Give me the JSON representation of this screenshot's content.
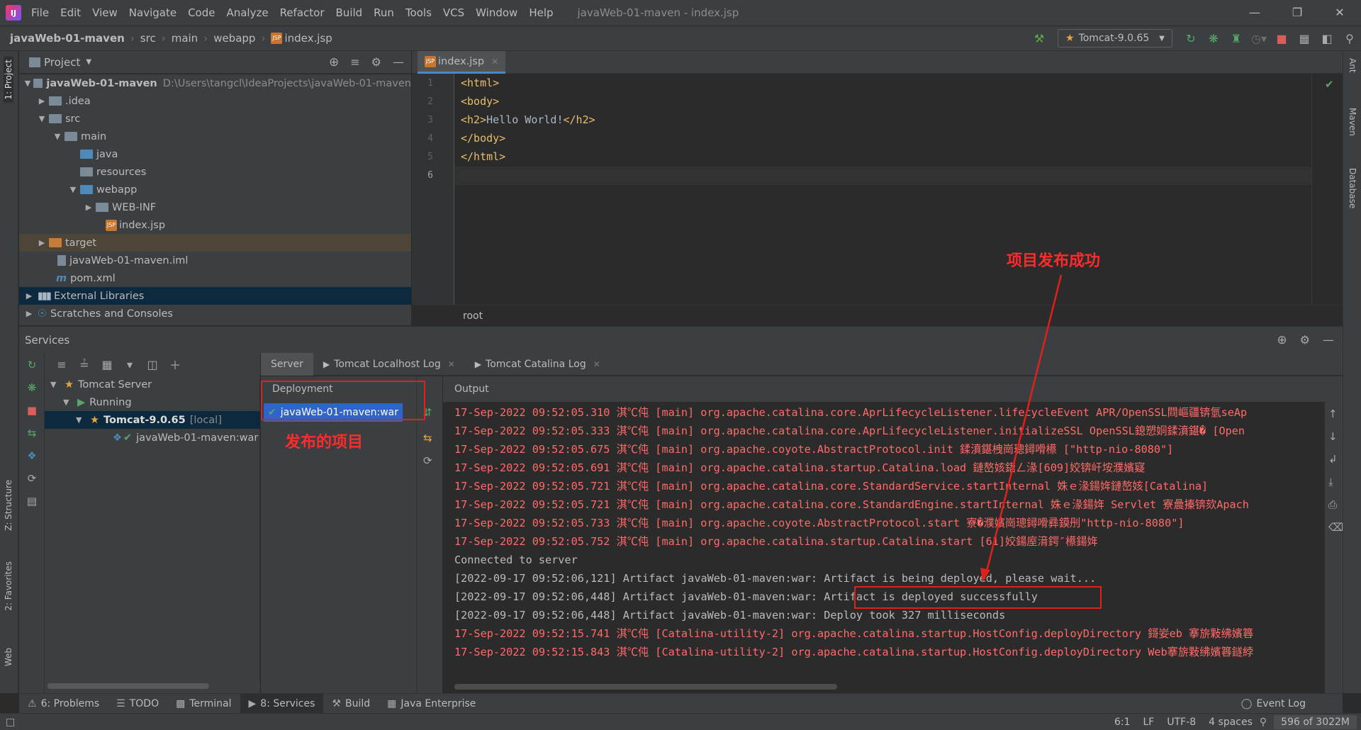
{
  "menubar": {
    "items": [
      "File",
      "Edit",
      "View",
      "Navigate",
      "Code",
      "Analyze",
      "Refactor",
      "Build",
      "Run",
      "Tools",
      "VCS",
      "Window",
      "Help"
    ],
    "window_title": "javaWeb-01-maven - index.jsp"
  },
  "navbar": {
    "crumbs": [
      "javaWeb-01-maven",
      "src",
      "main",
      "webapp",
      "index.jsp"
    ],
    "run_config": "Tomcat-9.0.65"
  },
  "left_strip": {
    "project": "1: Project",
    "structure": "Z: Structure",
    "favorites": "2: Favorites",
    "web": "Web"
  },
  "right_strip": {
    "ant": "Ant",
    "maven": "Maven",
    "database": "Database"
  },
  "project_panel": {
    "title": "Project",
    "tree": [
      {
        "label": "javaWeb-01-maven",
        "path": "D:\\Users\\tangcl\\IdeaProjects\\javaWeb-01-maven"
      },
      {
        "label": ".idea"
      },
      {
        "label": "src"
      },
      {
        "label": "main"
      },
      {
        "label": "java"
      },
      {
        "label": "resources"
      },
      {
        "label": "webapp"
      },
      {
        "label": "WEB-INF"
      },
      {
        "label": "index.jsp"
      },
      {
        "label": "target"
      },
      {
        "label": "javaWeb-01-maven.iml"
      },
      {
        "label": "pom.xml"
      },
      {
        "label": "External Libraries"
      },
      {
        "label": "Scratches and Consoles"
      }
    ]
  },
  "editor": {
    "tab": "index.jsp",
    "line_numbers": [
      "1",
      "2",
      "3",
      "4",
      "5",
      "6"
    ],
    "lines": [
      {
        "tag": "<html>",
        "text": ""
      },
      {
        "tag": "<body>",
        "text": ""
      },
      {
        "tag": "<h2>",
        "text": "Hello World!",
        "tag2": "</h2>"
      },
      {
        "tag": "</body>",
        "text": ""
      },
      {
        "tag": "</html>",
        "text": ""
      }
    ],
    "breadcrumb": "root"
  },
  "services": {
    "title": "Services",
    "tree": [
      {
        "label": "Tomcat Server"
      },
      {
        "label": "Running"
      },
      {
        "label": "Tomcat-9.0.65",
        "suffix": "[local]"
      },
      {
        "label": "javaWeb-01-maven:war"
      }
    ],
    "tabs": [
      "Server",
      "Tomcat Localhost Log",
      "Tomcat Catalina Log"
    ],
    "deployment_header": "Deployment",
    "deployment_item": "javaWeb-01-maven:war",
    "output_header": "Output",
    "log": [
      {
        "kind": "red",
        "text": "17-Sep-2022 09:52:05.310 淇℃伅 [main] org.apache.catalina.core.AprLifecycleListener.lifecycleEvent APR/OpenSSL閰嶇疆锛氫seAp"
      },
      {
        "kind": "red",
        "text": "17-Sep-2022 09:52:05.333 淇℃伅 [main] org.apache.catalina.core.AprLifecycleListener.initializeSSL OpenSSL鎴愬姛鍒濆鍖� [Open"
      },
      {
        "kind": "red",
        "text": "17-Sep-2022 09:52:05.675 淇℃伅 [main] org.apache.coyote.AbstractProtocol.init 鍒濆鍖栧崗璁鐞嗗櫒 [\"http-nio-8080\"]"
      },
      {
        "kind": "red",
        "text": "17-Sep-2022 09:52:05.691 淇℃伅 [main] org.apache.catalina.startup.Catalina.load 鏈嶅姟鍣ㄥ湪[609]姣锛屽垵濮嬪寲"
      },
      {
        "kind": "red",
        "text": "17-Sep-2022 09:52:05.721 淇℃伅 [main] org.apache.catalina.core.StandardService.startInternal 姝ｅ湪鍚姩鏈嶅姟[Catalina]"
      },
      {
        "kind": "red",
        "text": "17-Sep-2022 09:52:05.721 淇℃伅 [main] org.apache.catalina.core.StandardEngine.startInternal 姝ｅ湪鍚姩 Servlet 寮曟搸锛欬Apach"
      },
      {
        "kind": "red",
        "text": "17-Sep-2022 09:52:05.733 淇℃伅 [main] org.apache.coyote.AbstractProtocol.start 寮�濮嬪崗璁鐞嗗彞鏌刐\"http-nio-8080\"]"
      },
      {
        "kind": "red",
        "text": "17-Sep-2022 09:52:05.752 淇℃伅 [main] org.apache.catalina.startup.Catalina.start [61]姣鍚庢湇鍔″櫒鍚姩"
      },
      {
        "kind": "norm",
        "text": "Connected to server"
      },
      {
        "kind": "norm",
        "text": "[2022-09-17 09:52:06,121] Artifact javaWeb-01-maven:war: Artifact is being deployed, please wait..."
      },
      {
        "kind": "norm",
        "text": "[2022-09-17 09:52:06,448] Artifact javaWeb-01-maven:war: Artifact is deployed successfully"
      },
      {
        "kind": "norm",
        "text": "[2022-09-17 09:52:06,448] Artifact javaWeb-01-maven:war: Deploy took 327 milliseconds"
      },
      {
        "kind": "red",
        "text": "17-Sep-2022 09:52:15.741 淇℃伅 [Catalina-utility-2] org.apache.catalina.startup.HostConfig.deployDirectory 鎶妛eb 搴旂敤绋嬪簭"
      },
      {
        "kind": "red",
        "text": "17-Sep-2022 09:52:15.843 淇℃伅 [Catalina-utility-2] org.apache.catalina.startup.HostConfig.deployDirectory Web搴旂敤绋嬪簭鐩綍"
      }
    ]
  },
  "annotations": {
    "deployed_project": "发布的项目",
    "publish_success": "项目发布成功"
  },
  "bottom_tools": [
    "6: Problems",
    "TODO",
    "Terminal",
    "8: Services",
    "Build",
    "Java Enterprise"
  ],
  "event_log": "Event Log",
  "status": {
    "position": "6:1",
    "line_sep": "LF",
    "encoding": "UTF-8",
    "indent": "4 spaces",
    "memory": "596 of 3022M"
  },
  "colors": {
    "accent": "#2f65ca",
    "annotation_red": "#e0201c",
    "log_red": "#ff6b68",
    "bg": "#2b2b2b",
    "panel": "#3c3f41"
  }
}
